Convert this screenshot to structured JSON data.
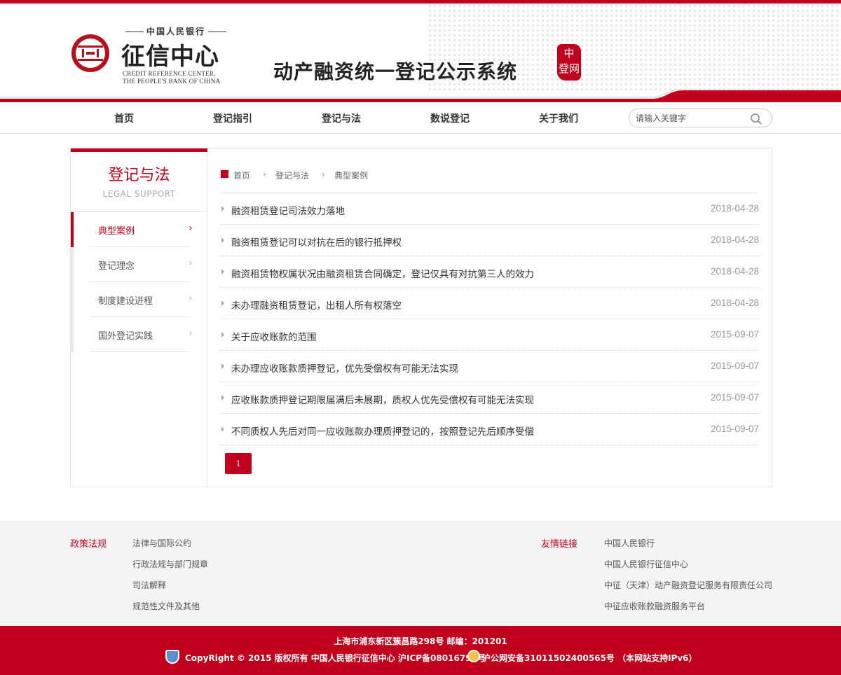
{
  "header": {
    "logo_top": "中国人民银行",
    "logo_name": "征信中心",
    "logo_en_line1": "CREDIT REFERENCE CENTER,",
    "logo_en_line2": "THE PEOPLE'S BANK OF CHINA",
    "system_title": "动产融资统一登记公示系统",
    "seal_text": "中登网"
  },
  "nav": {
    "items": [
      "首页",
      "登记指引",
      "登记与法",
      "数说登记",
      "关于我们"
    ],
    "search_placeholder": "请输入关键字"
  },
  "sidebar": {
    "title": "登记与法",
    "subtitle": "LEGAL SUPPORT",
    "items": [
      {
        "label": "典型案例",
        "active": true
      },
      {
        "label": "登记理念",
        "active": false
      },
      {
        "label": "制度建设进程",
        "active": false
      },
      {
        "label": "国外登记实践",
        "active": false
      }
    ]
  },
  "breadcrumb": [
    "首页",
    "登记与法",
    "典型案例"
  ],
  "articles": [
    {
      "title": "融资租赁登记司法效力落地",
      "date": "2018-04-28"
    },
    {
      "title": "融资租赁登记可以对抗在后的银行抵押权",
      "date": "2018-04-28"
    },
    {
      "title": "融资租赁物权属状况由融资租赁合同确定，登记仅具有对抗第三人的效力",
      "date": "2018-04-28"
    },
    {
      "title": "未办理融资租赁登记，出租人所有权落空",
      "date": "2018-04-28"
    },
    {
      "title": "关于应收账款的范围",
      "date": "2015-09-07"
    },
    {
      "title": "未办理应收账款质押登记，优先受偿权有可能无法实现",
      "date": "2015-09-07"
    },
    {
      "title": "应收账款质押登记期限届满后未展期，质权人优先受偿权有可能无法实现",
      "date": "2015-09-07"
    },
    {
      "title": "不同质权人先后对同一应收账款办理质押登记的，按照登记先后顺序受偿",
      "date": "2015-09-07"
    }
  ],
  "pagination": {
    "current": "1"
  },
  "footer": {
    "policy_heading": "政策法规",
    "policy_links": [
      "法律与国际公约",
      "行政法规与部门规章",
      "司法解释",
      "规范性文件及其他"
    ],
    "friend_heading": "友情链接",
    "friend_links": [
      "中国人民银行",
      "中国人民银行征信中心",
      "中征（天津）动产融资登记服务有限责任公司",
      "中征应收账款融资服务平台"
    ],
    "address": "上海市浦东新区簇昌路298号 邮编：201201",
    "copyright": "CopyRight © 2015 版权所有 中国人民银行征信中心 沪ICP备08016794号",
    "police": "沪公网安备31011502400565号 （本网站支持IPv6）"
  },
  "colors": {
    "brand_red": "#c0001d"
  }
}
